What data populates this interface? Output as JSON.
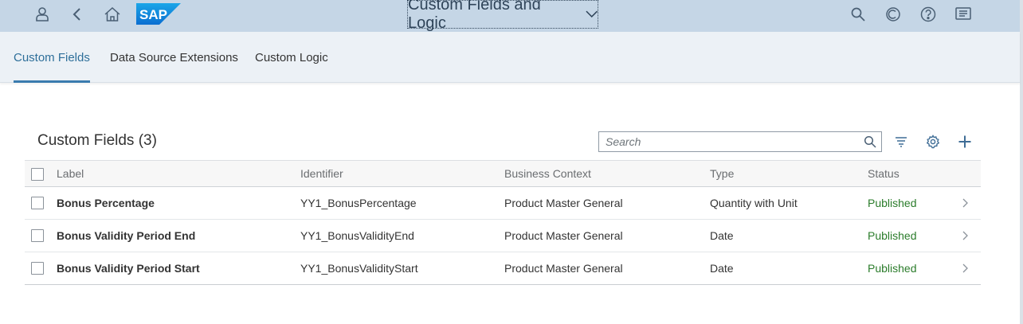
{
  "shell": {
    "icons": [
      "user-icon",
      "back-icon",
      "home-icon",
      "search-icon",
      "copilot-icon",
      "help-icon",
      "notifications-icon"
    ],
    "logo_text": "SAP",
    "app_title": "Custom Fields and Logic",
    "brand_color": "#0a6ed1"
  },
  "tabs": [
    {
      "label": "Custom Fields",
      "active": true
    },
    {
      "label": "Data Source Extensions",
      "active": false
    },
    {
      "label": "Custom Logic",
      "active": false
    }
  ],
  "table": {
    "title": "Custom Fields (3)",
    "search_placeholder": "Search",
    "columns": [
      "Label",
      "Identifier",
      "Business Context",
      "Type",
      "Status"
    ],
    "rows": [
      {
        "label": "Bonus Percentage",
        "identifier": "YY1_BonusPercentage",
        "context": "Product Master General",
        "type": "Quantity with Unit",
        "status": "Published"
      },
      {
        "label": "Bonus Validity Period End",
        "identifier": "YY1_BonusValidityEnd",
        "context": "Product Master General",
        "type": "Date",
        "status": "Published"
      },
      {
        "label": "Bonus Validity Period Start",
        "identifier": "YY1_BonusValidityStart",
        "context": "Product Master General",
        "type": "Date",
        "status": "Published"
      }
    ]
  },
  "colors": {
    "status_published": "#2b7c2b",
    "tab_active": "#3a7bae"
  }
}
